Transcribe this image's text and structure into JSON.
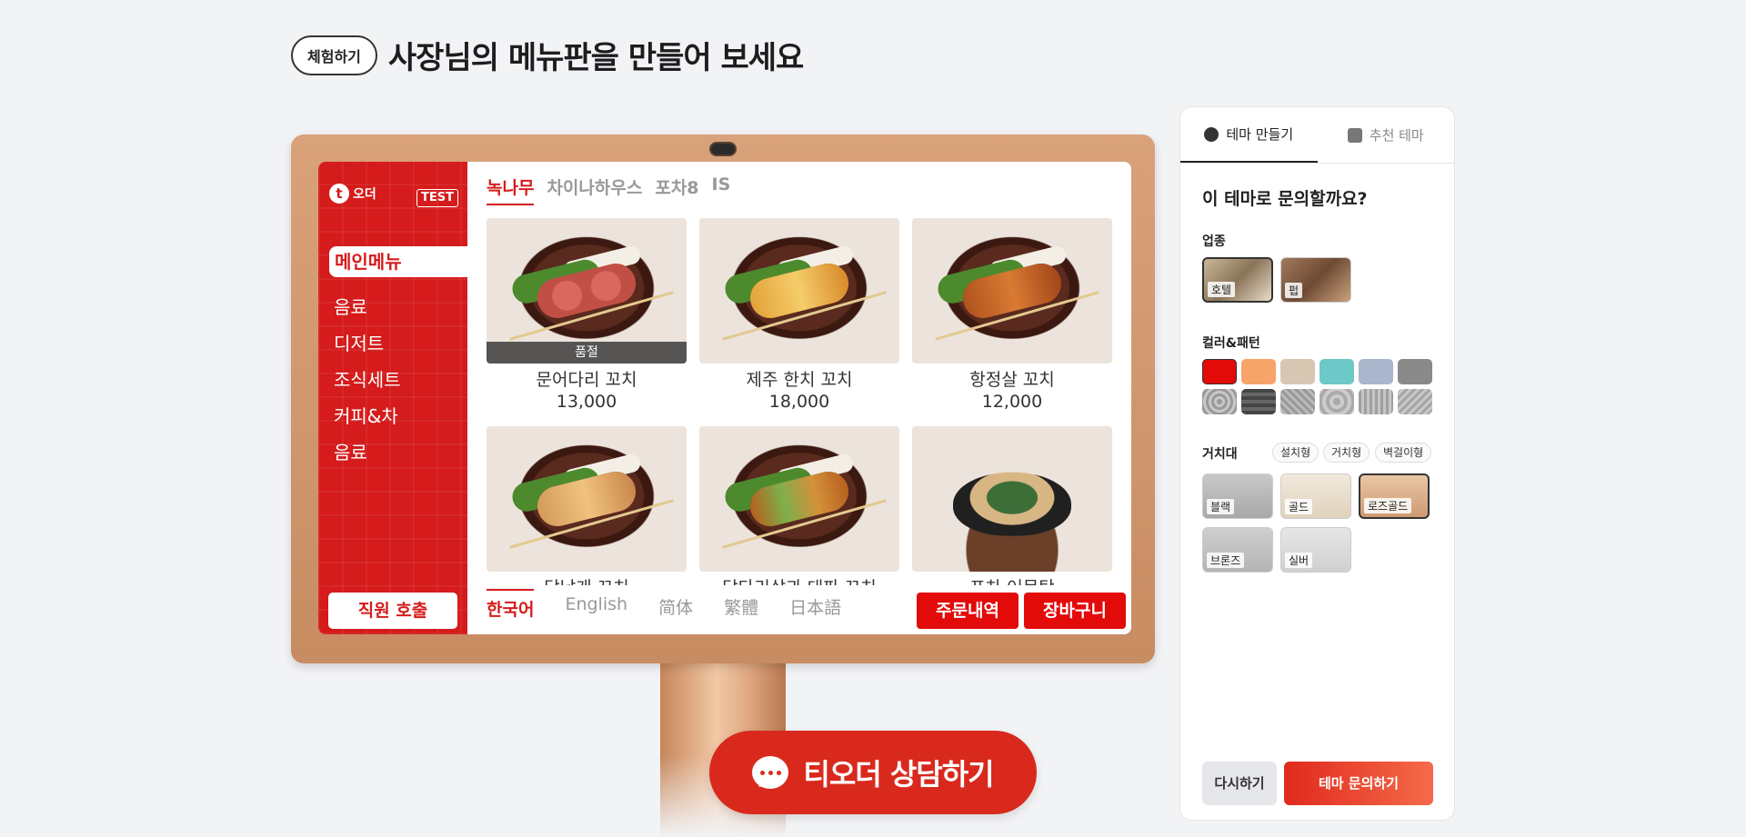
{
  "header": {
    "badge": "체험하기",
    "title": "사장님의 메뉴판을 만들어 보세요"
  },
  "kiosk": {
    "brand": "오더",
    "test_badge": "TEST",
    "active_category": "메인메뉴",
    "categories": [
      "음료",
      "디저트",
      "조식세트",
      "커피&차",
      "음료"
    ],
    "staff_call": "직원 호출",
    "stores": [
      "녹나무",
      "차이나하우스",
      "포차8",
      "IS"
    ],
    "menu": [
      {
        "name": "문어다리 꼬치",
        "price": "13,000",
        "soldout": "품절"
      },
      {
        "name": "제주 한치 꼬치",
        "price": "18,000"
      },
      {
        "name": "항정살 꼬치",
        "price": "12,000"
      },
      {
        "name": "닭날개 꼬치"
      },
      {
        "name": "닭다리살과 대파 꼬치"
      },
      {
        "name": "포차 어묵탕"
      }
    ],
    "languages": [
      "한국어",
      "English",
      "简体",
      "繁體",
      "日本語"
    ],
    "order_history": "주문내역",
    "cart": "장바구니"
  },
  "cta": {
    "label": "티오더 상담하기"
  },
  "panel": {
    "tabs": [
      "테마 만들기",
      "추천 테마"
    ],
    "question": "이 테마로 문의할까요?",
    "industry_label": "업종",
    "industries": [
      "호텔",
      "펍"
    ],
    "color_label": "컬러&패턴",
    "colors": [
      "#e30a0a",
      "#f7a46a",
      "#d6c6b2",
      "#6cc9c8",
      "#a9b6cc",
      "#8a8a8a"
    ],
    "stand_label": "거치대",
    "stand_types": [
      "설치형",
      "거치형",
      "벽걸이형"
    ],
    "stands": [
      "블랙",
      "골드",
      "로즈골드",
      "브론즈",
      "실버"
    ],
    "reset": "다시하기",
    "inquiry": "테마 문의하기"
  }
}
